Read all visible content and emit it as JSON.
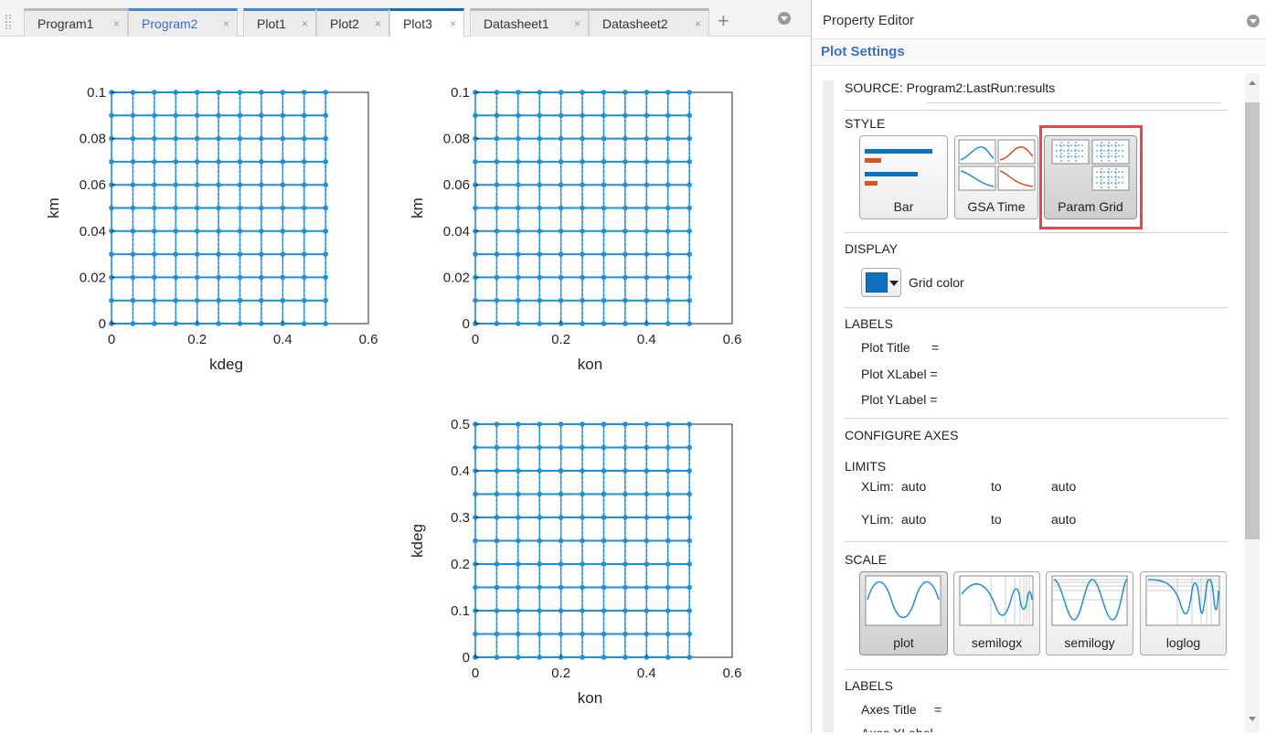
{
  "tabs": [
    {
      "label": "Program1",
      "color": "#333333"
    },
    {
      "label": "Program2",
      "color": "#3c6fc8"
    },
    {
      "label": "Plot1",
      "color": "#333333"
    },
    {
      "label": "Plot2",
      "color": "#333333"
    },
    {
      "label": "Plot3",
      "color": "#333333",
      "active": true
    },
    {
      "label": "Datasheet1",
      "color": "#333333"
    },
    {
      "label": "Datasheet2",
      "color": "#333333"
    }
  ],
  "tab_close_glyph": "×",
  "add_tab_glyph": "+",
  "property_editor": {
    "title": "Property Editor",
    "subtitle": "Plot Settings",
    "source": "SOURCE:  Program2:LastRun:results",
    "style": {
      "heading": "STYLE",
      "options": [
        "Bar",
        "GSA Time",
        "Param Grid"
      ],
      "selected": "Param Grid",
      "highlight_color": "#e8464d"
    },
    "display": {
      "heading": "DISPLAY",
      "grid_color_label": "Grid color",
      "grid_color": "#0d72c0"
    },
    "labels": {
      "heading": "LABELS",
      "plot_title": "Plot Title      =",
      "plot_xlabel": "Plot XLabel =",
      "plot_ylabel": "Plot YLabel ="
    },
    "configure_axes": {
      "heading": "CONFIGURE AXES",
      "limits_heading": "LIMITS",
      "xlim_label": "XLim:",
      "xlim_from": "auto",
      "xlim_to": "auto",
      "ylim_label": "YLim:",
      "ylim_from": "auto",
      "ylim_to": "auto",
      "to_label": "to"
    },
    "scale": {
      "heading": "SCALE",
      "options": [
        "plot",
        "semilogx",
        "semilogy",
        "loglog"
      ],
      "selected": "plot"
    },
    "axes_labels": {
      "heading": "LABELS",
      "axes_title": "Axes Title     =",
      "axes_xlabel_partial": "Axes XLabel"
    }
  },
  "chart_data": [
    {
      "type": "scatter",
      "style": "param-grid",
      "title": "",
      "xlabel": "kdeg",
      "ylabel": "km",
      "xlim": [
        0,
        0.6
      ],
      "ylim": [
        0,
        0.1
      ],
      "x_ticks": [
        "0",
        "0.2",
        "0.4",
        "0.6"
      ],
      "y_ticks": [
        "0",
        "0.02",
        "0.04",
        "0.06",
        "0.08",
        "0.1"
      ],
      "x_values": [
        0,
        0.05,
        0.1,
        0.15,
        0.2,
        0.25,
        0.3,
        0.35,
        0.4,
        0.45,
        0.5
      ],
      "y_values": [
        0,
        0.01,
        0.02,
        0.03,
        0.04,
        0.05,
        0.06,
        0.07,
        0.08,
        0.09,
        0.1
      ],
      "color": "#1f8fd8"
    },
    {
      "type": "scatter",
      "style": "param-grid",
      "title": "",
      "xlabel": "kon",
      "ylabel": "km",
      "xlim": [
        0,
        0.6
      ],
      "ylim": [
        0,
        0.1
      ],
      "x_ticks": [
        "0",
        "0.2",
        "0.4",
        "0.6"
      ],
      "y_ticks": [
        "0",
        "0.02",
        "0.04",
        "0.06",
        "0.08",
        "0.1"
      ],
      "x_values": [
        0,
        0.05,
        0.1,
        0.15,
        0.2,
        0.25,
        0.3,
        0.35,
        0.4,
        0.45,
        0.5
      ],
      "y_values": [
        0,
        0.01,
        0.02,
        0.03,
        0.04,
        0.05,
        0.06,
        0.07,
        0.08,
        0.09,
        0.1
      ],
      "color": "#1f8fd8"
    },
    {
      "type": "scatter",
      "style": "param-grid",
      "title": "",
      "xlabel": "kon",
      "ylabel": "kdeg",
      "xlim": [
        0,
        0.6
      ],
      "ylim": [
        0,
        0.5
      ],
      "x_ticks": [
        "0",
        "0.2",
        "0.4",
        "0.6"
      ],
      "y_ticks": [
        "0",
        "0.1",
        "0.2",
        "0.3",
        "0.4",
        "0.5"
      ],
      "x_values": [
        0,
        0.05,
        0.1,
        0.15,
        0.2,
        0.25,
        0.3,
        0.35,
        0.4,
        0.45,
        0.5
      ],
      "y_values": [
        0,
        0.05,
        0.1,
        0.15,
        0.2,
        0.25,
        0.3,
        0.35,
        0.4,
        0.45,
        0.5
      ],
      "color": "#1f8fd8"
    }
  ]
}
